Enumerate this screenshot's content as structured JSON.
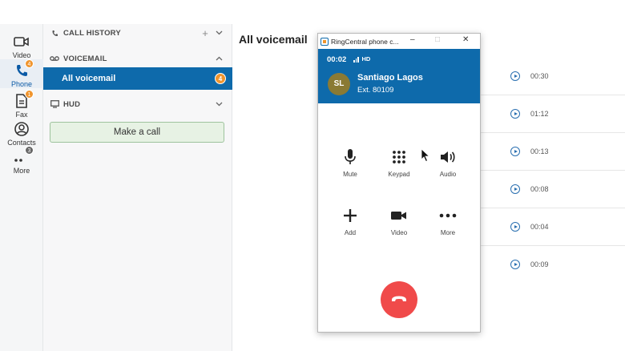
{
  "rail": {
    "items": [
      {
        "label": "Video",
        "icon": "video-icon"
      },
      {
        "label": "Phone",
        "icon": "phone-icon",
        "badge": "4"
      },
      {
        "label": "Fax",
        "icon": "fax-icon",
        "badge": "1"
      },
      {
        "label": "Contacts",
        "icon": "contacts-icon"
      },
      {
        "label": "More",
        "icon": "more-icon",
        "badge": "3"
      }
    ]
  },
  "panel": {
    "call_history": "CALL HISTORY",
    "voicemail": "VOICEMAIL",
    "all_voicemail": "All voicemail",
    "all_voicemail_badge": "4",
    "hud": "HUD",
    "make_call": "Make a call"
  },
  "main": {
    "title": "All voicemail",
    "durations": [
      "00:30",
      "01:12",
      "00:13",
      "00:08",
      "00:04",
      "00:09"
    ]
  },
  "phone_window": {
    "title": "RingCentral phone c...",
    "timer": "00:02",
    "quality": "HD",
    "avatar_initials": "SL",
    "caller_name": "Santiago Lagos",
    "extension": "Ext. 80109",
    "controls": {
      "mute": "Mute",
      "keypad": "Keypad",
      "audio": "Audio",
      "add": "Add",
      "video": "Video",
      "more": "More"
    }
  },
  "colors": {
    "brand_blue": "#0e6aab",
    "badge_orange": "#f0952e",
    "hangup_red": "#f04a4a"
  }
}
